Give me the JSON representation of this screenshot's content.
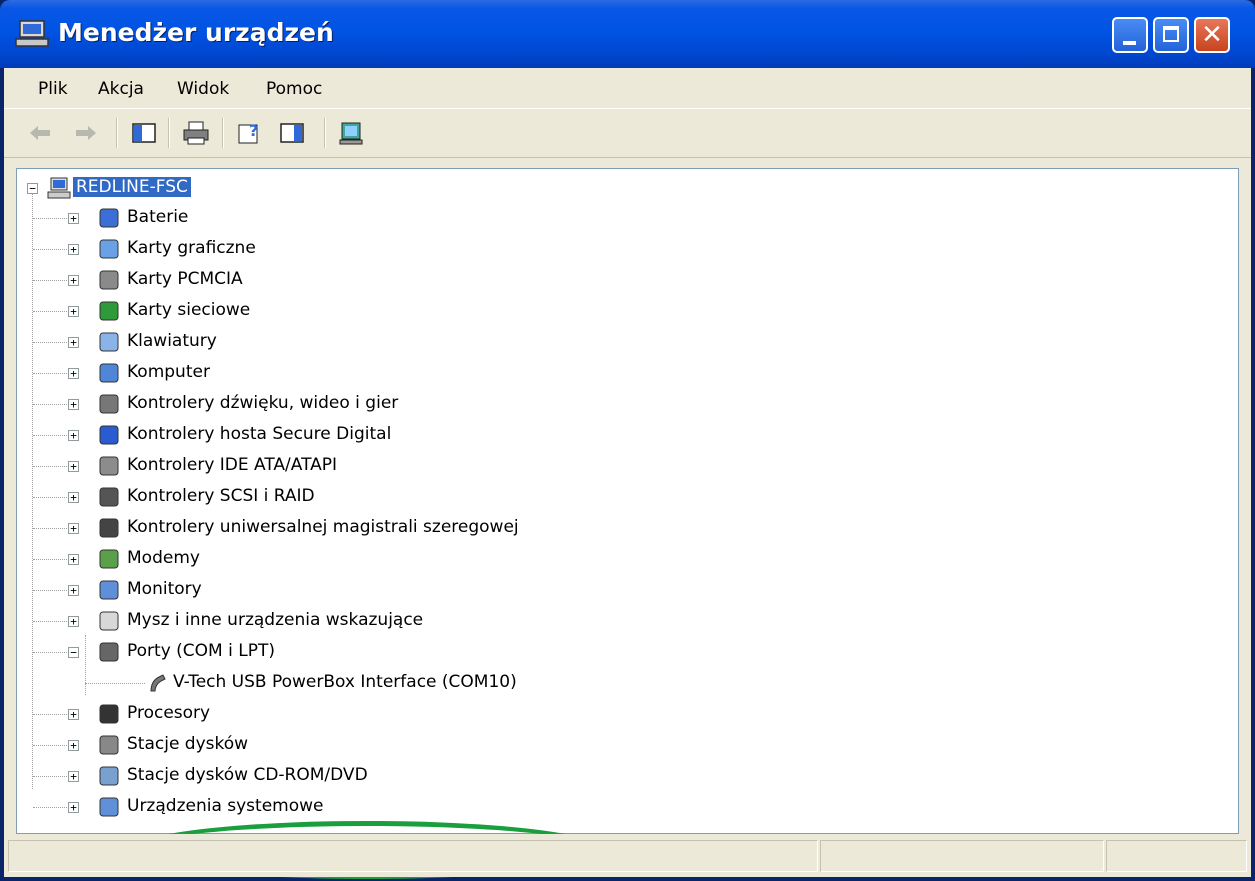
{
  "window": {
    "title": "Menedżer urządzeń"
  },
  "menu": [
    "Plik",
    "Akcja",
    "Widok",
    "Pomoc"
  ],
  "toolbar": {
    "buttons": [
      "back-icon",
      "forward-icon",
      "show-hide-console-tree-icon",
      "print-icon",
      "properties-help-icon",
      "show-hide-action-pane-icon",
      "scan-hardware-icon"
    ]
  },
  "tree": {
    "root": "REDLINE-FSC",
    "categories": [
      {
        "label": "Baterie",
        "icon": "battery-icon"
      },
      {
        "label": "Karty graficzne",
        "icon": "display-adapter-icon"
      },
      {
        "label": "Karty PCMCIA",
        "icon": "pcmcia-icon"
      },
      {
        "label": "Karty sieciowe",
        "icon": "network-card-icon"
      },
      {
        "label": "Klawiatury",
        "icon": "keyboard-icon"
      },
      {
        "label": "Komputer",
        "icon": "computer-icon"
      },
      {
        "label": "Kontrolery dźwięku, wideo i gier",
        "icon": "sound-icon"
      },
      {
        "label": "Kontrolery hosta Secure Digital",
        "icon": "sd-host-icon"
      },
      {
        "label": "Kontrolery IDE ATA/ATAPI",
        "icon": "ide-controller-icon"
      },
      {
        "label": "Kontrolery SCSI i RAID",
        "icon": "scsi-icon"
      },
      {
        "label": "Kontrolery uniwersalnej magistrali szeregowej",
        "icon": "usb-icon"
      },
      {
        "label": "Modemy",
        "icon": "modem-icon"
      },
      {
        "label": "Monitory",
        "icon": "monitor-icon"
      },
      {
        "label": "Mysz i inne urządzenia wskazujące",
        "icon": "mouse-icon"
      },
      {
        "label": "Porty (COM i LPT)",
        "icon": "port-icon",
        "expanded": true,
        "children": [
          {
            "label": "V-Tech USB PowerBox Interface (COM10)",
            "icon": "port-icon"
          }
        ]
      },
      {
        "label": "Procesory",
        "icon": "processor-icon"
      },
      {
        "label": "Stacje dysków",
        "icon": "disk-drive-icon"
      },
      {
        "label": "Stacje dysków CD-ROM/DVD",
        "icon": "cdrom-icon"
      },
      {
        "label": "Urządzenia systemowe",
        "icon": "system-device-icon"
      }
    ]
  },
  "colors": {
    "selection": "#316ac5",
    "highlight_ring": "#1a9e3e",
    "titlebar": "#0054e3"
  }
}
